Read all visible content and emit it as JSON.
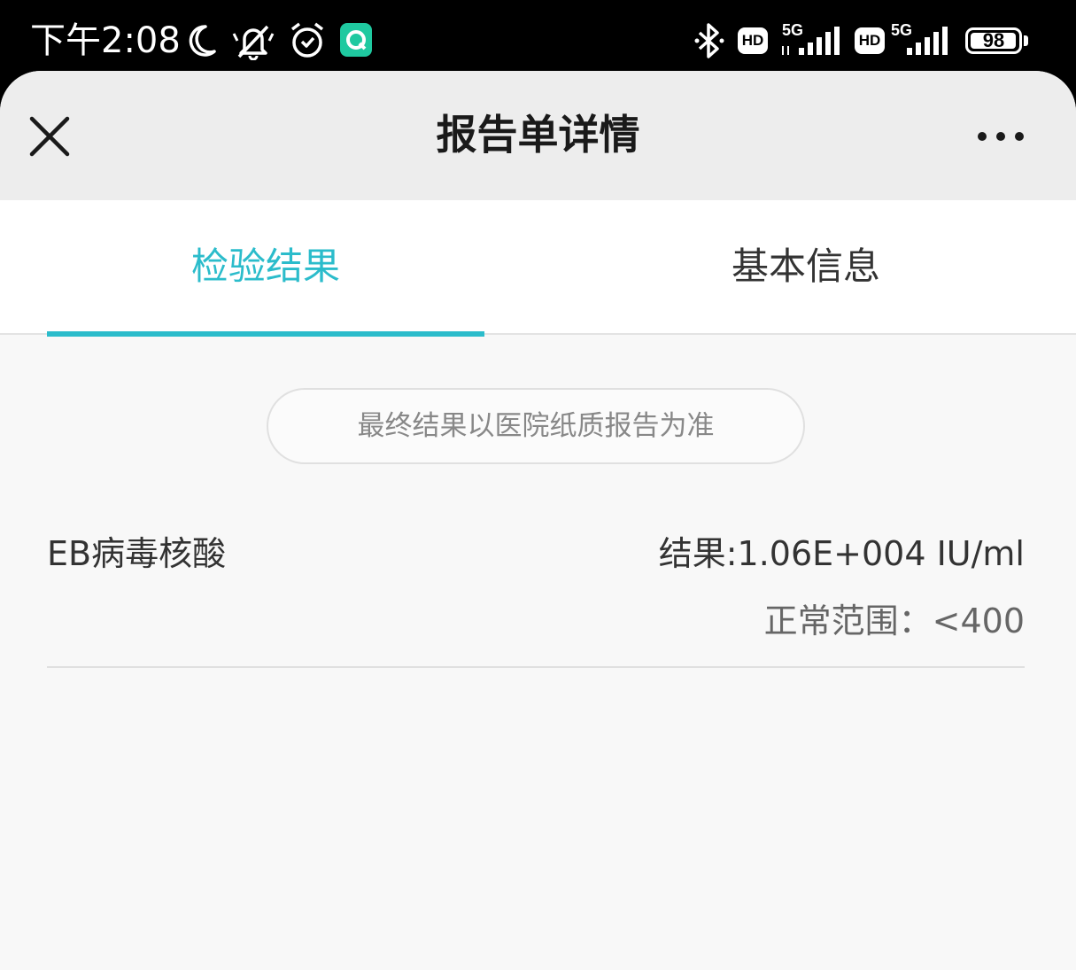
{
  "status_bar": {
    "time": "下午2:08",
    "icons": [
      "moon-icon",
      "mute-icon",
      "alarm-icon",
      "app-notification-icon",
      "bluetooth-icon",
      "hd-icon",
      "signal-5g-icon",
      "hd-icon",
      "signal-5g-icon",
      "battery-icon"
    ],
    "hd_label": "HD",
    "network_label": "5G",
    "battery_level": "98",
    "battery_fraction": 0.98,
    "app_icon_color": "#1fc9a0"
  },
  "header": {
    "title": "报告单详情",
    "close_icon": "close-icon",
    "more_icon": "more-icon"
  },
  "tabs": [
    {
      "label": "检验结果",
      "active": true
    },
    {
      "label": "基本信息",
      "active": false
    }
  ],
  "accent_color": "#2bbccb",
  "notice": "最终结果以医院纸质报告为准",
  "results": [
    {
      "name": "EB病毒核酸",
      "result": "结果:1.06E+004 IU/ml",
      "range": "正常范围：<400"
    }
  ]
}
